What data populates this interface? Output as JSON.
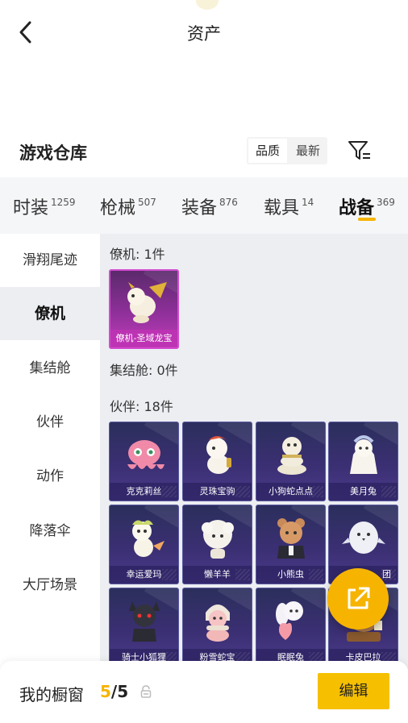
{
  "header": {
    "title": "资产",
    "back_icon": "chevron-left-icon"
  },
  "section": {
    "title": "游戏仓库",
    "sort_options": [
      "品质",
      "最新"
    ],
    "sort_active": "品质",
    "filter_icon": "filter-icon"
  },
  "tabs": [
    {
      "label": "时装",
      "count": "1259"
    },
    {
      "label": "枪械",
      "count": "507"
    },
    {
      "label": "装备",
      "count": "876"
    },
    {
      "label": "载具",
      "count": "14"
    },
    {
      "label": "战备",
      "count": "369",
      "active": true
    }
  ],
  "sidebar": [
    "滑翔尾迹",
    "僚机",
    "集结舱",
    "伙伴",
    "动作",
    "降落伞",
    "大厅场景"
  ],
  "sidebar_active": "僚机",
  "groups": {
    "wingman": {
      "title": "僚机: 1件",
      "items": [
        {
          "name": "僚机-圣域龙宝",
          "icon": "dragon-icon"
        }
      ]
    },
    "pod": {
      "title": "集结舱: 0件"
    },
    "partner": {
      "title": "伙伴: 18件",
      "items": [
        {
          "name": "克克莉丝",
          "icon": "octopus-icon"
        },
        {
          "name": "灵珠宝驹",
          "icon": "horse-icon"
        },
        {
          "name": "小狗蛇点点",
          "icon": "snake-icon"
        },
        {
          "name": "美月兔",
          "icon": "rabbit-doll-icon"
        },
        {
          "name": "幸运爱玛",
          "icon": "sheep-icon"
        },
        {
          "name": "懒羊羊",
          "icon": "lamb-icon"
        },
        {
          "name": "小熊虫",
          "icon": "bear-icon"
        },
        {
          "name": "团",
          "icon": "bird-icon"
        },
        {
          "name": "骑士小狐狸",
          "icon": "fox-icon"
        },
        {
          "name": "粉雪蛇宝",
          "icon": "pink-snake-icon"
        },
        {
          "name": "眠眠兔",
          "icon": "bunny-icon"
        },
        {
          "name": "卡皮巴拉",
          "icon": "capybara-icon"
        }
      ]
    }
  },
  "float_button": {
    "icon": "external-link-icon"
  },
  "bottom": {
    "label": "我的橱窗",
    "current": "5",
    "total": "/5",
    "lock_icon": "lock-icon",
    "edit_label": "编辑"
  },
  "colors": {
    "accent": "#f5b400",
    "card_purple": "#c03cb9",
    "card_dark": "#3b2f73"
  }
}
